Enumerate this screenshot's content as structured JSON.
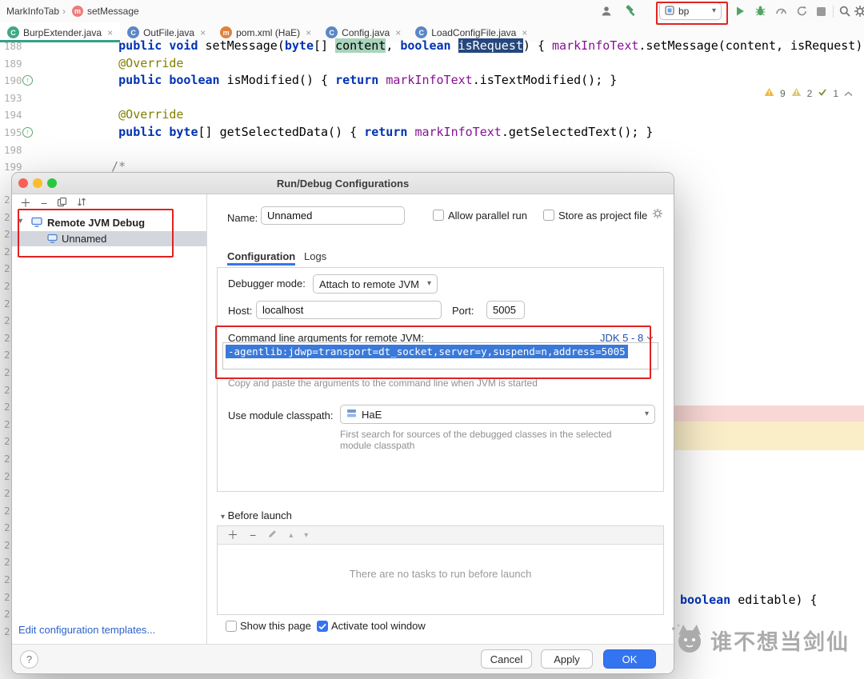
{
  "topbar": {
    "breadcrumb_root": "MarkInfoTab",
    "breadcrumb_separator": "›",
    "breadcrumb_method": "setMessage",
    "run_config_name": "bp"
  },
  "tabs": [
    {
      "label": "BurpExtender.java",
      "icon_letter": "C"
    },
    {
      "label": "OutFile.java",
      "icon_letter": "C"
    },
    {
      "label": "pom.xml (HaE)",
      "icon_letter": "m"
    },
    {
      "label": "Config.java",
      "icon_letter": "C"
    },
    {
      "label": "LoadConfigFile.java",
      "icon_letter": "C"
    }
  ],
  "editor": {
    "inspections": {
      "warnings": "9",
      "weak_warnings": "2",
      "passed": "1"
    },
    "lines": [
      {
        "num": "188",
        "tokens": [
          {
            "t": "     "
          },
          {
            "c": "kw",
            "t": "public void "
          },
          {
            "t": "setMessage("
          },
          {
            "c": "kw",
            "t": "byte"
          },
          {
            "t": "[] "
          },
          {
            "c": "hlgreen",
            "t": "content"
          },
          {
            "t": ", "
          },
          {
            "c": "kw",
            "t": "boolean "
          },
          {
            "c": "hlblue",
            "t": "isRequest"
          },
          {
            "t": ") { "
          },
          {
            "c": "field",
            "t": "markInfoText"
          },
          {
            "t": ".setMessage(content, isRequest); }"
          }
        ]
      },
      {
        "num": "189",
        "tokens": [
          {
            "t": "     "
          },
          {
            "c": "ann",
            "t": "@Override"
          }
        ]
      },
      {
        "num": "190",
        "icon": true,
        "tokens": [
          {
            "t": "     "
          },
          {
            "c": "kw",
            "t": "public boolean "
          },
          {
            "t": "isModified() { "
          },
          {
            "c": "kw",
            "t": "return "
          },
          {
            "c": "field",
            "t": "markInfoText"
          },
          {
            "t": ".isTextModified(); }"
          }
        ]
      },
      {
        "num": "193",
        "tokens": []
      },
      {
        "num": "194",
        "tokens": [
          {
            "t": "     "
          },
          {
            "c": "ann",
            "t": "@Override"
          }
        ]
      },
      {
        "num": "195",
        "icon": true,
        "tokens": [
          {
            "t": "     "
          },
          {
            "c": "kw",
            "t": "public byte"
          },
          {
            "t": "[] getSelectedData() { "
          },
          {
            "c": "kw",
            "t": "return "
          },
          {
            "c": "field",
            "t": "markInfoText"
          },
          {
            "t": ".getSelectedText(); }"
          }
        ]
      },
      {
        "num": "198",
        "tokens": []
      },
      {
        "num": "199",
        "tokens": [
          {
            "c": "cmt",
            "t": "    /*"
          }
        ]
      }
    ],
    "gutter_overflow": {
      "digit": "2",
      "rows": 26
    },
    "side_code": {
      "keyword": "boolean",
      "rest": " editable) {"
    }
  },
  "dialog": {
    "title": "Run/Debug Configurations",
    "tree": {
      "group_label": "Remote JVM Debug",
      "item_label": "Unnamed"
    },
    "name_label": "Name:",
    "name_value": "Unnamed",
    "allow_parallel_label": "Allow parallel run",
    "store_project_label": "Store as project file",
    "tab_configuration": "Configuration",
    "tab_logs": "Logs",
    "debugger_mode_label": "Debugger mode:",
    "debugger_mode_value": "Attach to remote JVM",
    "host_label": "Host:",
    "host_value": "localhost",
    "port_label": "Port:",
    "port_value": "5005",
    "cmd_args_label": "Command line arguments for remote JVM:",
    "jdk_selector": "JDK 5 - 8",
    "cmd_args_value": "-agentlib:jdwp=transport=dt_socket,server=y,suspend=n,address=5005",
    "cmd_args_help": "Copy and paste the arguments to the command line when JVM is started",
    "classpath_label": "Use module classpath:",
    "classpath_value": "HaE",
    "classpath_help_1": "First search for sources of the debugged classes in the selected",
    "classpath_help_2": "module classpath",
    "before_launch_label": "Before launch",
    "no_tasks_text": "There are no tasks to run before launch",
    "show_page_label": "Show this page",
    "activate_tool_label": "Activate tool window",
    "cancel_label": "Cancel",
    "apply_label": "Apply",
    "ok_label": "OK",
    "edit_templates_label": "Edit configuration templates...",
    "help_label": "?"
  },
  "watermark": {
    "text": "谁不想当剑仙"
  }
}
